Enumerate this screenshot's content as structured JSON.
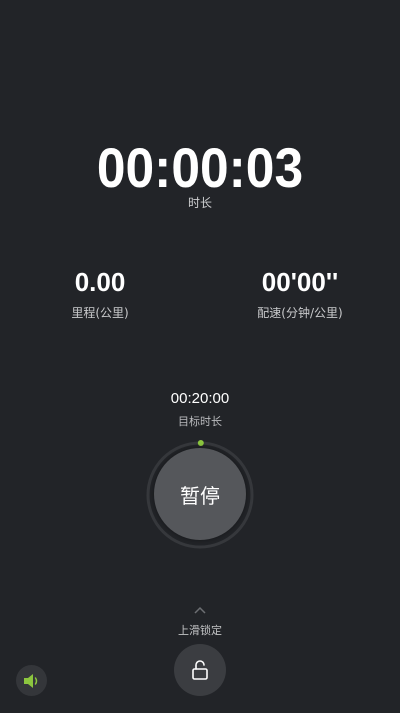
{
  "timer": {
    "elapsed": "00:00:03",
    "label": "时长"
  },
  "stats": {
    "distance": {
      "value": "0.00",
      "label": "里程(公里)"
    },
    "pace": {
      "value": "00'00''",
      "label": "配速(分钟/公里)"
    }
  },
  "goal": {
    "value": "00:20:00",
    "label": "目标时长",
    "progress_fraction": 0.0025
  },
  "controls": {
    "pause_label": "暂停",
    "slide_lock_label": "上滑锁定",
    "lock_icon": "unlock-icon",
    "sound_icon": "speaker-icon"
  },
  "colors": {
    "background": "#222428",
    "accent": "#8cc63f",
    "pause_button": "#55575b"
  }
}
